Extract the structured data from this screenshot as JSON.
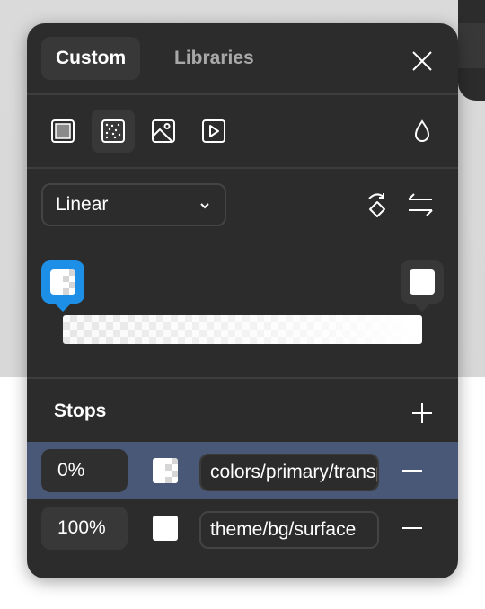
{
  "tabs": [
    {
      "label": "Custom",
      "active": true
    },
    {
      "label": "Libraries",
      "active": false
    }
  ],
  "close_icon": "close-icon",
  "fill_types": [
    "solid-fill-icon",
    "gradient-fill-icon",
    "image-fill-icon",
    "video-fill-icon"
  ],
  "selected_fill_type": "gradient",
  "opacity_icon": "drop-icon",
  "gradient": {
    "type": "Linear",
    "rotate_icon": "rotate-icon",
    "flip_icon": "swap-arrows-icon"
  },
  "accent_color": "#1e8fe6",
  "stops": {
    "title": "Stops",
    "add_icon": "plus-icon",
    "items": [
      {
        "position": "0%",
        "color_name": "colors/primary/transparent",
        "selected": true
      },
      {
        "position": "100%",
        "color_name": "theme/bg/surface",
        "selected": false
      }
    ]
  }
}
